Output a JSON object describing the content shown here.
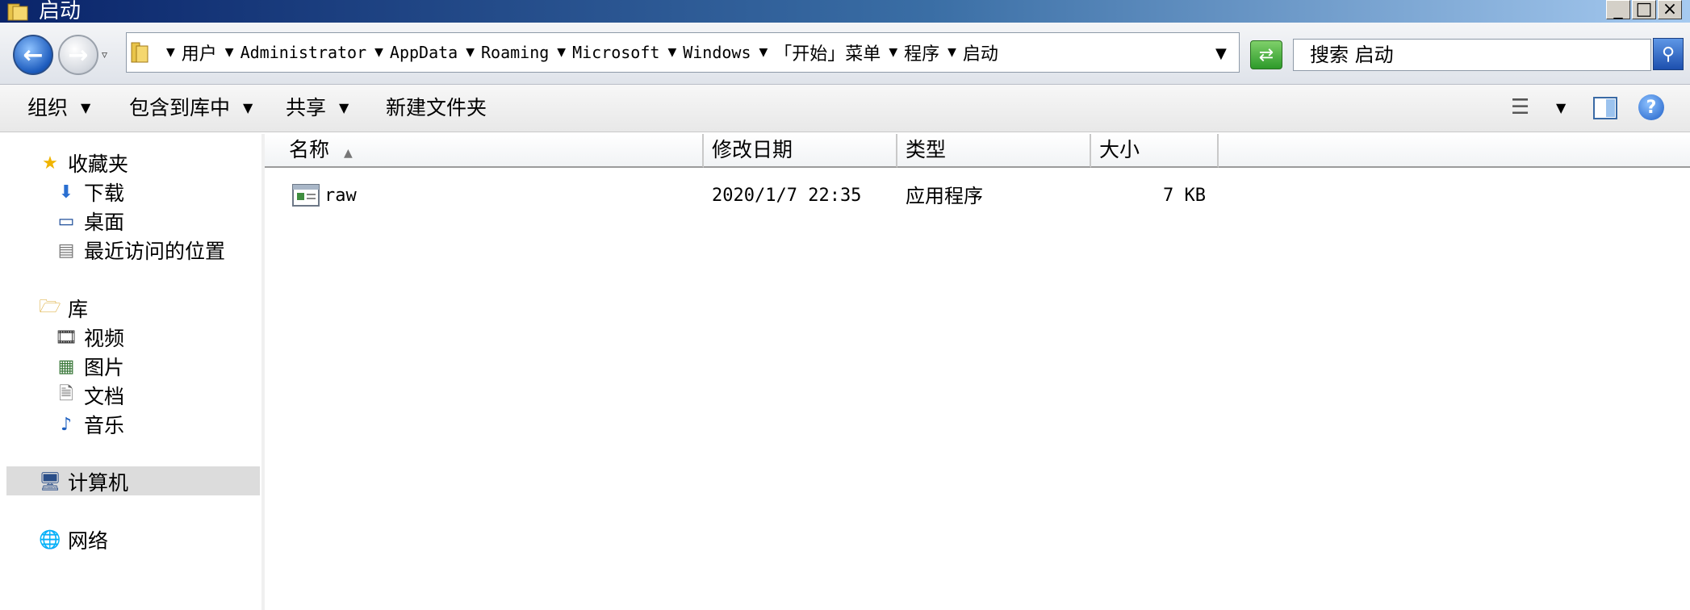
{
  "window": {
    "title": "启动",
    "minimize_label": "_",
    "maximize_label": "□",
    "close_label": "×"
  },
  "address_bar": {
    "crumbs": [
      "用户",
      "Administrator",
      "AppData",
      "Roaming",
      "Microsoft",
      "Windows",
      "「开始」菜单",
      "程序",
      "启动"
    ],
    "search_placeholder": "搜索 启动"
  },
  "toolbar": {
    "organize": "组织",
    "include_in_library": "包含到库中",
    "share": "共享",
    "new_folder": "新建文件夹"
  },
  "nav": {
    "favorites": {
      "label": "收藏夹",
      "items": [
        "下载",
        "桌面",
        "最近访问的位置"
      ]
    },
    "libraries": {
      "label": "库",
      "items": [
        "视频",
        "图片",
        "文档",
        "音乐"
      ]
    },
    "computer": "计算机",
    "network": "网络"
  },
  "columns": {
    "name": "名称",
    "date": "修改日期",
    "type": "类型",
    "size": "大小"
  },
  "files": [
    {
      "name": "raw",
      "date": "2020/1/7 22:35",
      "type": "应用程序",
      "size": "7 KB"
    }
  ],
  "icons": {
    "title": "folder-icon",
    "back": "back-arrow-icon",
    "forward": "forward-arrow-icon",
    "refresh": "refresh-icon",
    "search": "search-icon",
    "help": "help-icon"
  }
}
